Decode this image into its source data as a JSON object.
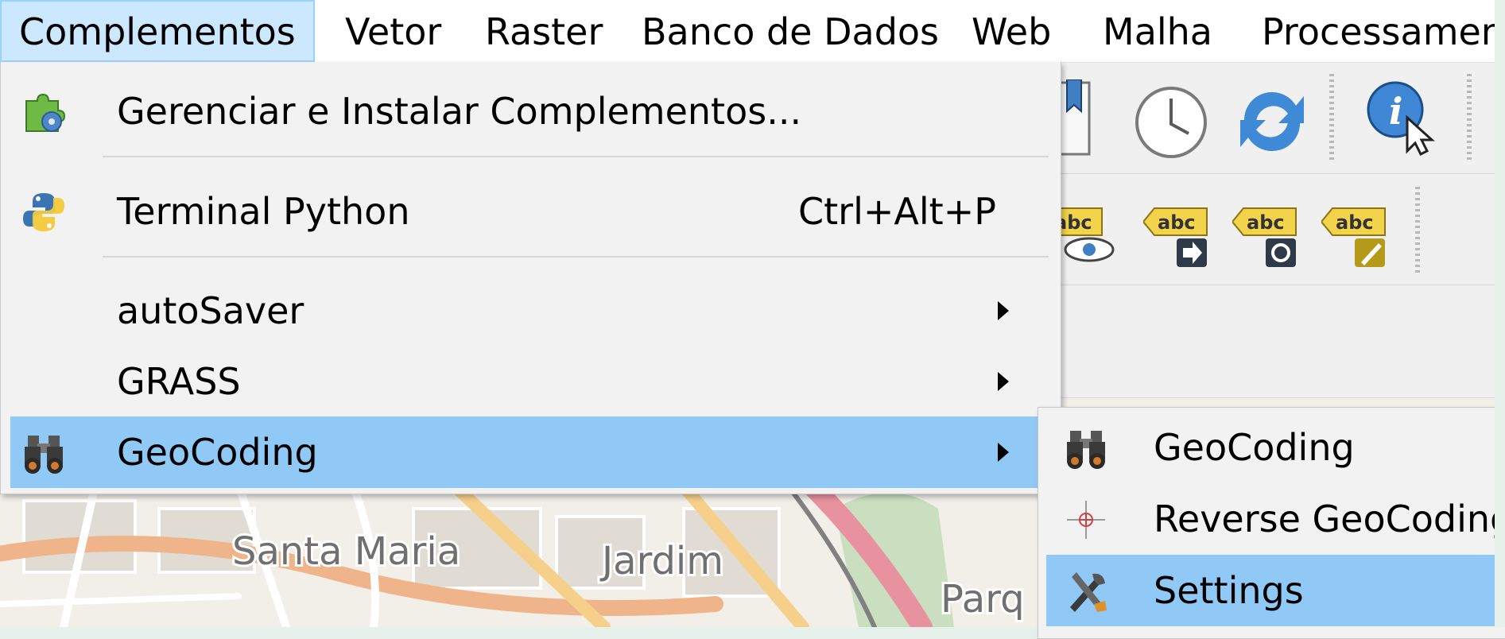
{
  "menubar": {
    "items": [
      {
        "label": "Complementos",
        "active": true
      },
      {
        "label": "Vetor"
      },
      {
        "label": "Raster"
      },
      {
        "label": "Banco de Dados"
      },
      {
        "label": "Web"
      },
      {
        "label": "Malha"
      },
      {
        "label": "Processament"
      }
    ]
  },
  "plugins_menu": {
    "items": [
      {
        "label": "Gerenciar e Instalar Complementos...",
        "icon": "puzzle-gear-icon"
      },
      {
        "label": "Terminal Python",
        "shortcut": "Ctrl+Alt+P",
        "icon": "python-icon"
      },
      {
        "label": "autoSaver",
        "has_submenu": true
      },
      {
        "label": "GRASS",
        "has_submenu": true
      },
      {
        "label": "GeoCoding",
        "has_submenu": true,
        "highlighted": true,
        "icon": "binoculars-icon"
      }
    ]
  },
  "geocoding_submenu": {
    "items": [
      {
        "label": "GeoCoding",
        "icon": "binoculars-icon"
      },
      {
        "label": "Reverse GeoCoding",
        "icon": "crosshair-icon"
      },
      {
        "label": "Settings",
        "icon": "tools-icon",
        "highlighted": true
      }
    ]
  },
  "toolbar": {
    "label_icon_text": "abc",
    "icons": [
      "bookmark-icon",
      "clock-icon",
      "refresh-icon",
      "identify-icon",
      "label-show-icon",
      "label-move-icon",
      "label-rotate-icon",
      "label-edit-icon"
    ]
  },
  "map": {
    "labels": [
      "Santa Maria",
      "Jardim",
      "Parq"
    ]
  },
  "colors": {
    "menu_highlight": "#90c8f6",
    "menubar_active": "#cce8ff",
    "menu_background": "#f2f2f2",
    "label_yellow": "#f2d34a"
  }
}
